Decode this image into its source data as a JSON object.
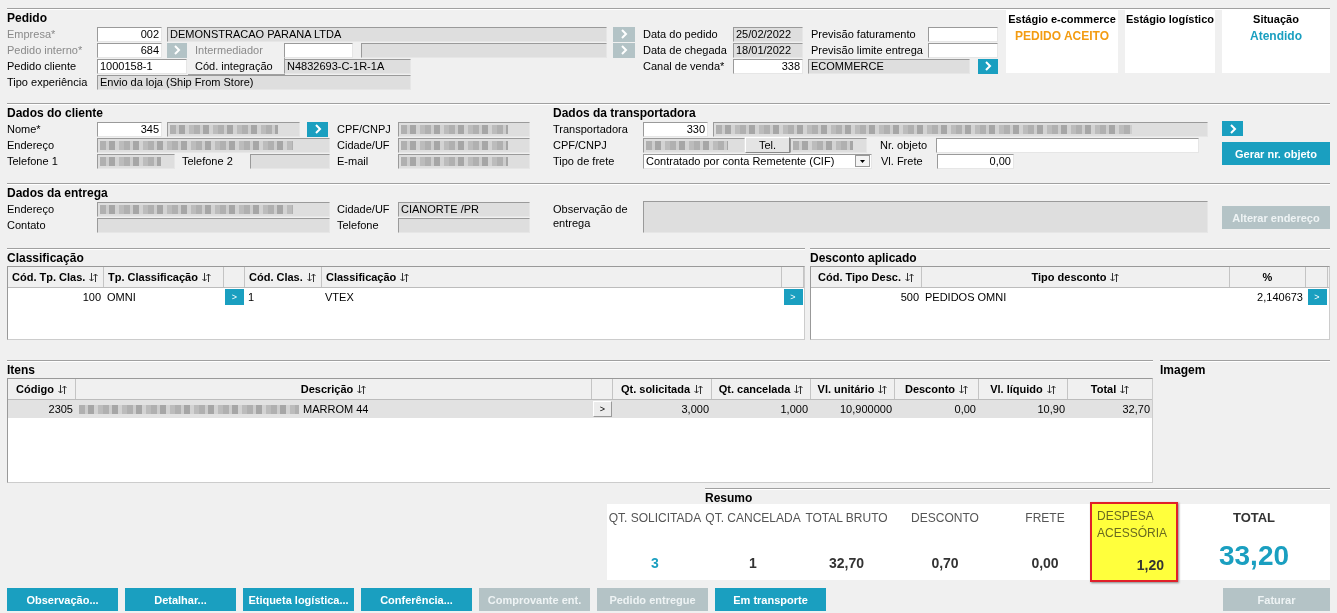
{
  "pedido": {
    "title": "Pedido",
    "empresa": {
      "label": "Empresa*",
      "disabled": true,
      "code": {
        "value": "002",
        "editable": true
      },
      "name": {
        "value": "DEMONSTRACAO PARANA LTDA",
        "editable": false
      },
      "lookup_disabled": true
    },
    "pedido_interno": {
      "label": "Pedido interno*",
      "disabled": true,
      "code": {
        "value": "684",
        "editable": true
      },
      "lookup_disabled": true
    },
    "intermediador": {
      "label": "Intermediador",
      "disabled": true,
      "code": {
        "editable": true
      },
      "name": {
        "editable": false
      },
      "lookup_disabled": true
    },
    "pedido_cliente": {
      "label": "Pedido cliente",
      "code": {
        "value": "1000158-1",
        "editable": true
      }
    },
    "cod_integracao": {
      "label": "Cód. integração",
      "name": {
        "value": "N4832693-C-1R-1A",
        "editable": false
      }
    },
    "tipo_experiencia": {
      "label": "Tipo experiência",
      "name": {
        "value": "Envio da loja (Ship From Store)",
        "editable": false
      }
    },
    "data_pedido": {
      "label": "Data do pedido",
      "code": {
        "value": "25/02/2022",
        "editable": false
      }
    },
    "data_chegada": {
      "label": "Data de chegada",
      "code": {
        "value": "18/01/2022",
        "editable": false
      }
    },
    "canal_venda": {
      "label": "Canal de venda*",
      "code": {
        "value": "338",
        "editable": true
      },
      "name": {
        "value": "ECOMMERCE",
        "editable": false
      },
      "lookup_disabled": false
    },
    "previsao_faturamento": {
      "label": "Previsão faturamento",
      "code": {
        "editable": true
      }
    },
    "previsao_limite_entrega": {
      "label": "Previsão limite entrega",
      "code": {
        "editable": true
      }
    }
  },
  "status_cards": [
    {
      "title": "Estágio e-commerce",
      "value": "PEDIDO ACEITO",
      "color": "#f39c12"
    },
    {
      "title": "Estágio logístico"
    },
    {
      "title": "Situação",
      "value": "Atendido",
      "color": "#1a9fc0"
    }
  ],
  "cliente": {
    "title": "Dados do cliente",
    "nome": {
      "label": "Nome*",
      "code": {
        "value": "345",
        "editable": true
      },
      "name": {
        "redacted": true,
        "editable": false
      },
      "lookup_disabled": false
    },
    "cpf_cnpj": {
      "label": "CPF/CNPJ",
      "name": {
        "redacted": true,
        "editable": false
      }
    },
    "endereco": {
      "label": "Endereço",
      "name": {
        "redacted": true,
        "editable": false
      }
    },
    "cidade_uf": {
      "label": "Cidade/UF",
      "name": {
        "redacted": true,
        "editable": false
      }
    },
    "telefone_1": {
      "label": "Telefone 1",
      "name": {
        "redacted": true,
        "editable": false
      }
    },
    "telefone_2": {
      "label": "Telefone 2",
      "name": {
        "editable": false
      }
    },
    "email": {
      "label": "E-mail",
      "name": {
        "redacted": true,
        "editable": false
      }
    }
  },
  "transportadora": {
    "title": "Dados da transportadora",
    "transportadora": {
      "label": "Transportadora",
      "code": {
        "value": "330",
        "editable": true
      },
      "name": {
        "redacted": true,
        "editable": false
      },
      "lookup_disabled": false
    },
    "cpf_cnpj": {
      "label": "CPF/CNPJ",
      "name": {
        "redacted": true,
        "editable": false
      }
    },
    "tel_button": "Tel.",
    "telefone": {
      "redacted": true,
      "editable": false
    },
    "nr_objeto": {
      "label": "Nr. objeto",
      "code": {
        "editable": true
      }
    },
    "tipo_frete": {
      "label": "Tipo de frete",
      "value": "Contratado por conta Remetente (CIF)"
    },
    "vl_frete": {
      "label": "Vl. Frete",
      "code": {
        "value": "0,00",
        "editable": true
      }
    },
    "gerar_button": {
      "label": "Gerar nr. objeto",
      "disabled": false
    }
  },
  "entrega": {
    "title": "Dados da entrega",
    "endereco": {
      "label": "Endereço",
      "name": {
        "redacted": true,
        "editable": false
      }
    },
    "cidade_uf": {
      "label": "Cidade/UF",
      "name": {
        "value": "CIANORTE /PR",
        "editable": false
      }
    },
    "contato": {
      "label": "Contato",
      "name": {
        "editable": false
      }
    },
    "telefone": {
      "label": "Telefone",
      "name": {
        "editable": false
      }
    },
    "observacao": {
      "label": "Observação de entrega",
      "name": {
        "editable": false
      }
    },
    "alterar_button": {
      "label": "Alterar endereço",
      "disabled": true
    }
  },
  "classificacao": {
    "title": "Classificação",
    "columns": [
      {
        "kind": "data",
        "label": "Cód. Tp. Clas.",
        "sortable": true
      },
      {
        "kind": "data",
        "label": "Tp. Classificação",
        "sortable": true
      },
      {
        "kind": "action"
      },
      {
        "kind": "data",
        "label": "Cód. Clas.",
        "sortable": true
      },
      {
        "kind": "data",
        "label": "Classificação",
        "sortable": true
      },
      {
        "kind": "action"
      }
    ],
    "rows": [
      {
        "selected": false,
        "cells": [
          "100",
          "OMNI",
          ">",
          "1",
          "VTEX",
          ">"
        ]
      }
    ]
  },
  "desconto": {
    "title": "Desconto aplicado",
    "columns": [
      {
        "kind": "data",
        "label": "Cód. Tipo Desc.",
        "sortable": true
      },
      {
        "kind": "data",
        "label": "Tipo desconto",
        "sortable": true
      },
      {
        "kind": "data",
        "label": "%",
        "sortable": false
      },
      {
        "kind": "action"
      }
    ],
    "rows": [
      {
        "selected": false,
        "cells": [
          "500",
          "PEDIDOS OMNI",
          "2,140673",
          ">"
        ]
      }
    ]
  },
  "itens": {
    "title": "Itens",
    "columns": [
      {
        "kind": "data",
        "label": "Código",
        "sortable": true
      },
      {
        "kind": "data",
        "label": "Descrição",
        "sortable": true
      },
      {
        "kind": "action"
      },
      {
        "kind": "data",
        "label": "Qt. solicitada",
        "sortable": true
      },
      {
        "kind": "data",
        "label": "Qt. cancelada",
        "sortable": true
      },
      {
        "kind": "data",
        "label": "Vl. unitário",
        "sortable": true
      },
      {
        "kind": "data",
        "label": "Desconto",
        "sortable": true
      },
      {
        "kind": "data",
        "label": "Vl. líquido",
        "sortable": true
      },
      {
        "kind": "data",
        "label": "Total",
        "sortable": true
      }
    ],
    "rows": [
      {
        "selected": true,
        "cells": [
          "2305",
          {
            "redacted": true,
            "value": "MARROM 44"
          },
          ">",
          "3,000",
          "1,000",
          "10,900000",
          "0,00",
          "10,90",
          "32,70"
        ]
      }
    ]
  },
  "imagem": {
    "title": "Imagem"
  },
  "resumo": {
    "title": "Resumo",
    "items": [
      {
        "kind": "metric",
        "label": "QT. SOLICITADA",
        "value": "3",
        "color": "#1a9fc0",
        "highlighted": false
      },
      {
        "kind": "metric",
        "label": "QT. CANCELADA",
        "value": "1",
        "color": "#333333",
        "highlighted": false
      },
      {
        "kind": "metric",
        "label": "TOTAL BRUTO",
        "value": "32,70",
        "color": "#333333",
        "highlighted": false
      },
      {
        "kind": "metric",
        "label": "DESCONTO",
        "value": "0,70",
        "color": "#333333",
        "highlighted": false
      },
      {
        "kind": "metric",
        "label": "FRETE",
        "value": "0,00",
        "color": "#333333",
        "highlighted": false
      },
      {
        "kind": "metric",
        "label": "DESPESA ACESSÓRIA",
        "value": "1,20",
        "color": "#333333",
        "highlighted": true
      },
      {
        "kind": "total",
        "label": "TOTAL",
        "value": "33,20",
        "color": "#1a9fc0",
        "highlighted": false
      }
    ]
  },
  "actions": [
    {
      "label": "Observação...",
      "disabled": false
    },
    {
      "label": "Detalhar...",
      "disabled": false
    },
    {
      "label": "Etiqueta logística...",
      "disabled": false
    },
    {
      "label": "Conferência...",
      "disabled": false
    },
    {
      "label": "Comprovante ent.",
      "disabled": true
    },
    {
      "label": "Pedido entregue",
      "disabled": true
    },
    {
      "label": "Em transporte",
      "disabled": false
    }
  ],
  "final_actions": [
    {
      "label": "Faturar",
      "disabled": true
    }
  ]
}
